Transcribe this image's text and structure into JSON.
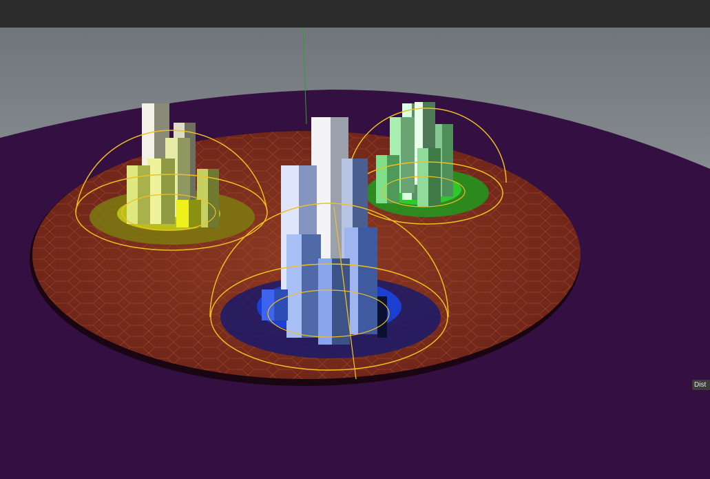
{
  "viewport": {
    "background_color": "#7e8488",
    "ground_color": "#341042",
    "platform_color": "#7a2a1a",
    "gizmo_color": "#f0c020",
    "axis_line_color": "#2aa03a"
  },
  "clusters": [
    {
      "name": "yellow-cluster",
      "top_color": "#e8ee9a",
      "side_color": "#b8c34a",
      "base_color": "#c8d21a"
    },
    {
      "name": "blue-cluster",
      "top_color": "#c8d8ff",
      "side_color": "#6f8fe0",
      "base_color": "#1b3fd0"
    },
    {
      "name": "green-cluster",
      "top_color": "#c8ffc8",
      "side_color": "#7fc88a",
      "base_color": "#22c022"
    }
  ],
  "overlay": {
    "dist_label": "Dist"
  }
}
